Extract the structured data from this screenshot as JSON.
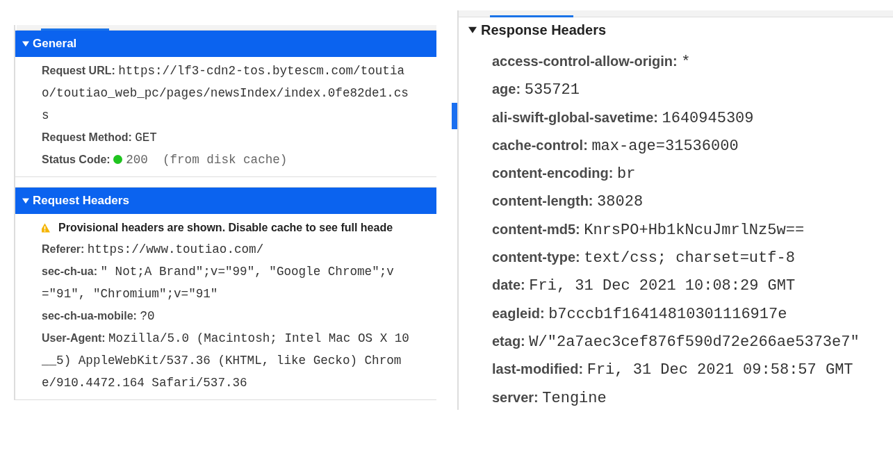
{
  "request_panel": {
    "sections": [
      {
        "title": "General",
        "expanded": true,
        "selected": true,
        "rows": [
          {
            "name": "Request URL:",
            "value": "https://lf3-cdn2-tos.bytescm.com/toutiao/toutiao_web_pc/pages/newsIndex/index.0fe82de1.css"
          },
          {
            "name": "Request Method:",
            "value": "GET"
          },
          {
            "name": "Status Code:",
            "value": "200  (from disk cache)",
            "kind": "status"
          }
        ]
      },
      {
        "title": "Request Headers",
        "expanded": true,
        "selected": true,
        "notice": "Provisional headers are shown. Disable cache to see full heade",
        "rows": [
          {
            "name": "Referer:",
            "value": "https://www.toutiao.com/"
          },
          {
            "name": "sec-ch-ua:",
            "value": "\" Not;A Brand\";v=\"99\", \"Google Chrome\";v=\"91\", \"Chromium\";v=\"91\""
          },
          {
            "name": "sec-ch-ua-mobile:",
            "value": "?0"
          },
          {
            "name": "User-Agent:",
            "value": "Mozilla/5.0 (Macintosh; Intel Mac OS X 10__5) AppleWebKit/537.36 (KHTML, like Gecko) Chrome/910.4472.164 Safari/537.36"
          }
        ]
      }
    ]
  },
  "response_panel": {
    "sections": [
      {
        "title": "Response Headers",
        "expanded": true,
        "selected": false,
        "rows": [
          {
            "name": "access-control-allow-origin:",
            "value": "*"
          },
          {
            "name": "age:",
            "value": "535721"
          },
          {
            "name": "ali-swift-global-savetime:",
            "value": "1640945309"
          },
          {
            "name": "cache-control:",
            "value": "max-age=31536000"
          },
          {
            "name": "content-encoding:",
            "value": "br"
          },
          {
            "name": "content-length:",
            "value": "38028"
          },
          {
            "name": "content-md5:",
            "value": "KnrsPO+Hb1kNcuJmrlNz5w=="
          },
          {
            "name": "content-type:",
            "value": "text/css; charset=utf-8"
          },
          {
            "name": "date:",
            "value": "Fri, 31 Dec 2021 10:08:29 GMT"
          },
          {
            "name": "eagleid:",
            "value": "b7cccb1f16414810301116917e"
          },
          {
            "name": "etag:",
            "value": "W/\"2a7aec3cef876f590d72e266ae5373e7\""
          },
          {
            "name": "last-modified:",
            "value": "Fri, 31 Dec 2021 09:58:57 GMT"
          },
          {
            "name": "server:",
            "value": "Tengine"
          }
        ]
      }
    ]
  }
}
